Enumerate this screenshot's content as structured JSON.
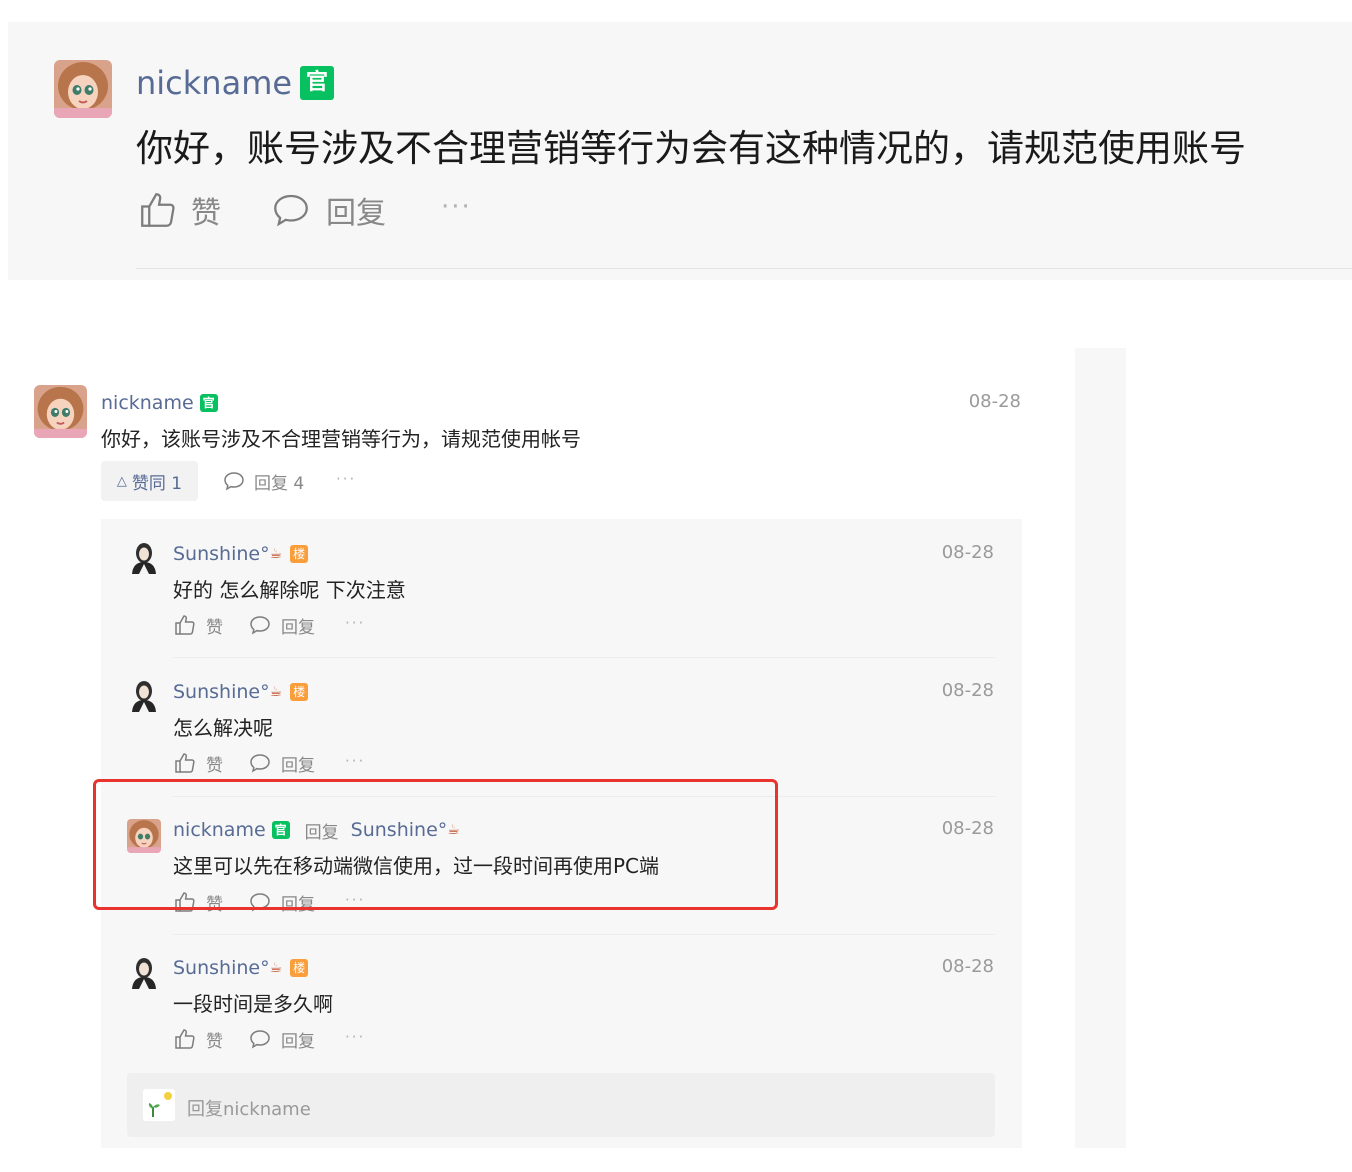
{
  "zoom_card": {
    "author": "nickname",
    "official_badge": "官",
    "text": "你好，账号涉及不合理营销等行为会有这种情况的，请规范使用账号",
    "like_label": "赞",
    "reply_label": "回复"
  },
  "thread": {
    "main": {
      "author": "nickname",
      "official_badge": "官",
      "date": "08-28",
      "text": "你好，该账号涉及不合理营销等行为，请规范使用帐号",
      "agree_label": "赞同 1",
      "reply_label": "回复 4"
    },
    "replies": [
      {
        "author": "Sunshine°",
        "emoji": "☕",
        "badge": "楼",
        "date": "08-28",
        "text": "好的 怎么解除呢 下次注意",
        "like_label": "赞",
        "reply_label": "回复"
      },
      {
        "author": "Sunshine°",
        "emoji": "☕",
        "badge": "楼",
        "date": "08-28",
        "text": "怎么解决呢",
        "like_label": "赞",
        "reply_label": "回复"
      },
      {
        "author": "nickname",
        "badge": "官",
        "reply_word": "回复",
        "reply_to": "Sunshine°",
        "reply_to_emoji": "☕",
        "date": "08-28",
        "text": "这里可以先在移动端微信使用，过一段时间再使用PC端",
        "like_label": "赞",
        "reply_label": "回复"
      },
      {
        "author": "Sunshine°",
        "emoji": "☕",
        "badge": "楼",
        "date": "08-28",
        "text": "一段时间是多久啊",
        "like_label": "赞",
        "reply_label": "回复"
      }
    ],
    "reply_input_placeholder": "回复nickname"
  },
  "colors": {
    "link": "#576b95",
    "official": "#07c160",
    "floor_badge": "#fa9d3b",
    "highlight": "#e8332f"
  },
  "icons": [
    "thumbs-up-icon",
    "comment-bubble-icon",
    "more-dots-icon",
    "agree-triangle-icon"
  ]
}
